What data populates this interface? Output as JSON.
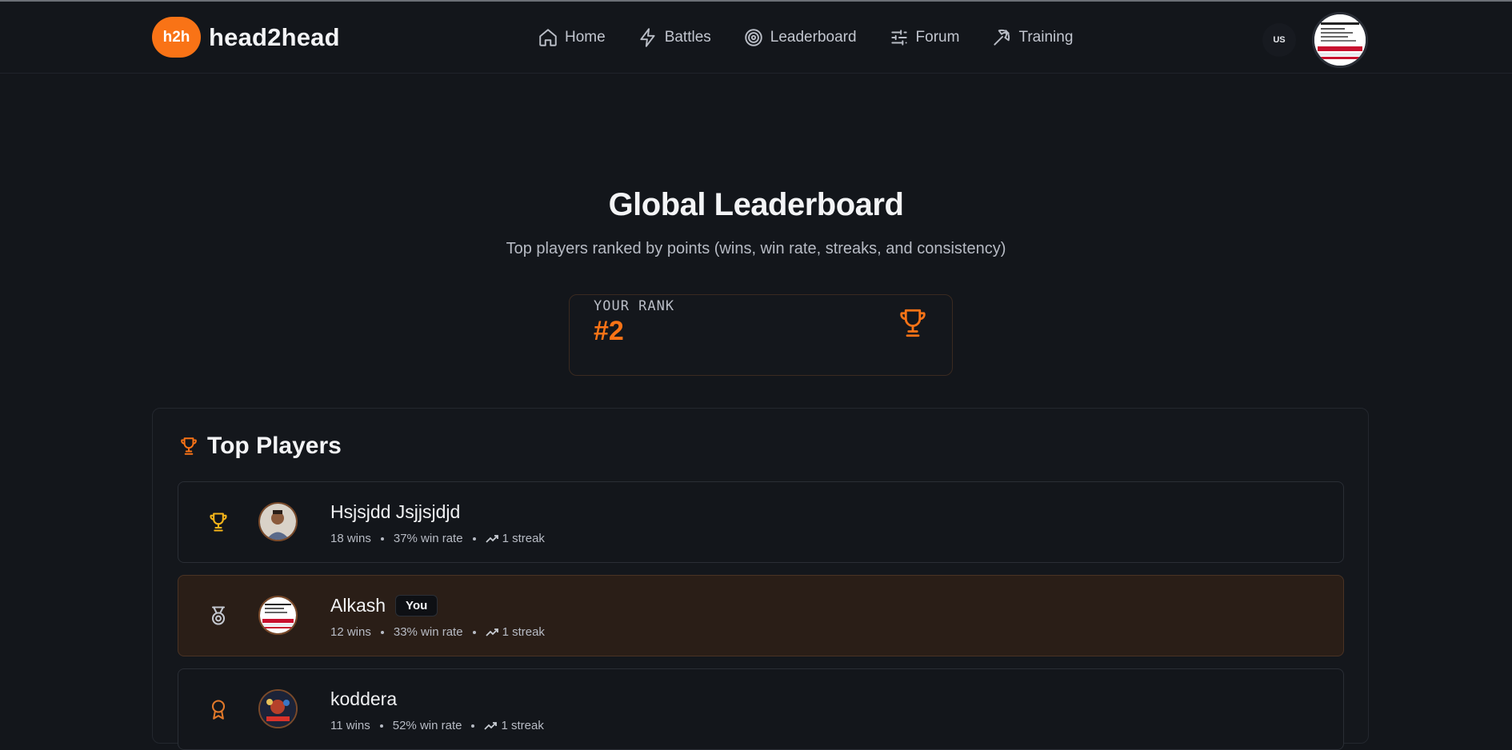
{
  "brand": {
    "badge": "h2h",
    "name": "head2head",
    "accent": "#f97316"
  },
  "nav": [
    {
      "label": "Home",
      "icon": "home-icon"
    },
    {
      "label": "Battles",
      "icon": "lightning-icon"
    },
    {
      "label": "Leaderboard",
      "icon": "target-icon"
    },
    {
      "label": "Forum",
      "icon": "sliders-icon"
    },
    {
      "label": "Training",
      "icon": "pickaxe-icon"
    }
  ],
  "header": {
    "locale": "US"
  },
  "hero": {
    "title": "Global Leaderboard",
    "subtitle": "Top players ranked by points (wins, win rate, streaks, and consistency)"
  },
  "rank_card": {
    "label": "YOUR RANK",
    "value": "#2"
  },
  "top_players": {
    "title": "Top Players",
    "rows": [
      {
        "name": "Hsjsjdd Jsjjsjdjd",
        "wins": "18 wins",
        "win_rate": "37% win rate",
        "streak": "1 streak",
        "you": false
      },
      {
        "name": "Alkash",
        "badge": "You",
        "wins": "12 wins",
        "win_rate": "33% win rate",
        "streak": "1 streak",
        "you": true
      },
      {
        "name": "koddera",
        "wins": "11 wins",
        "win_rate": "52% win rate",
        "streak": "1 streak",
        "you": false
      }
    ]
  }
}
